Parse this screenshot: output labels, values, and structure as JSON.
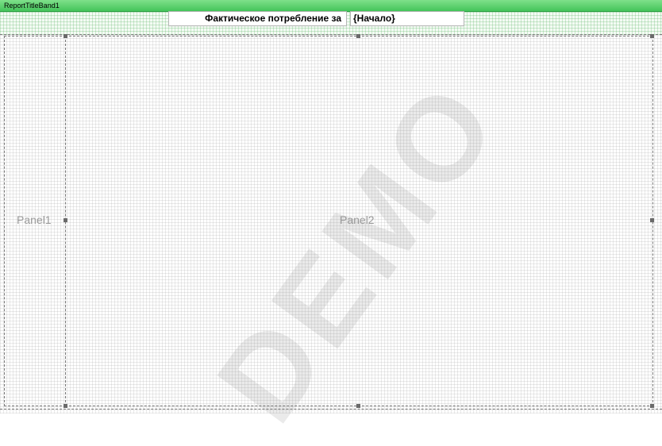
{
  "band": {
    "name": "ReportTitleBand1"
  },
  "title_fields": {
    "left_text": "Фактическое потребление за",
    "right_text": "{Начало}"
  },
  "panels": [
    {
      "label": "Panel1"
    },
    {
      "label": "Panel2"
    }
  ],
  "watermark": "DEMO",
  "colors": {
    "band_green": "#44c45a",
    "grid": "#cfcfcf"
  }
}
